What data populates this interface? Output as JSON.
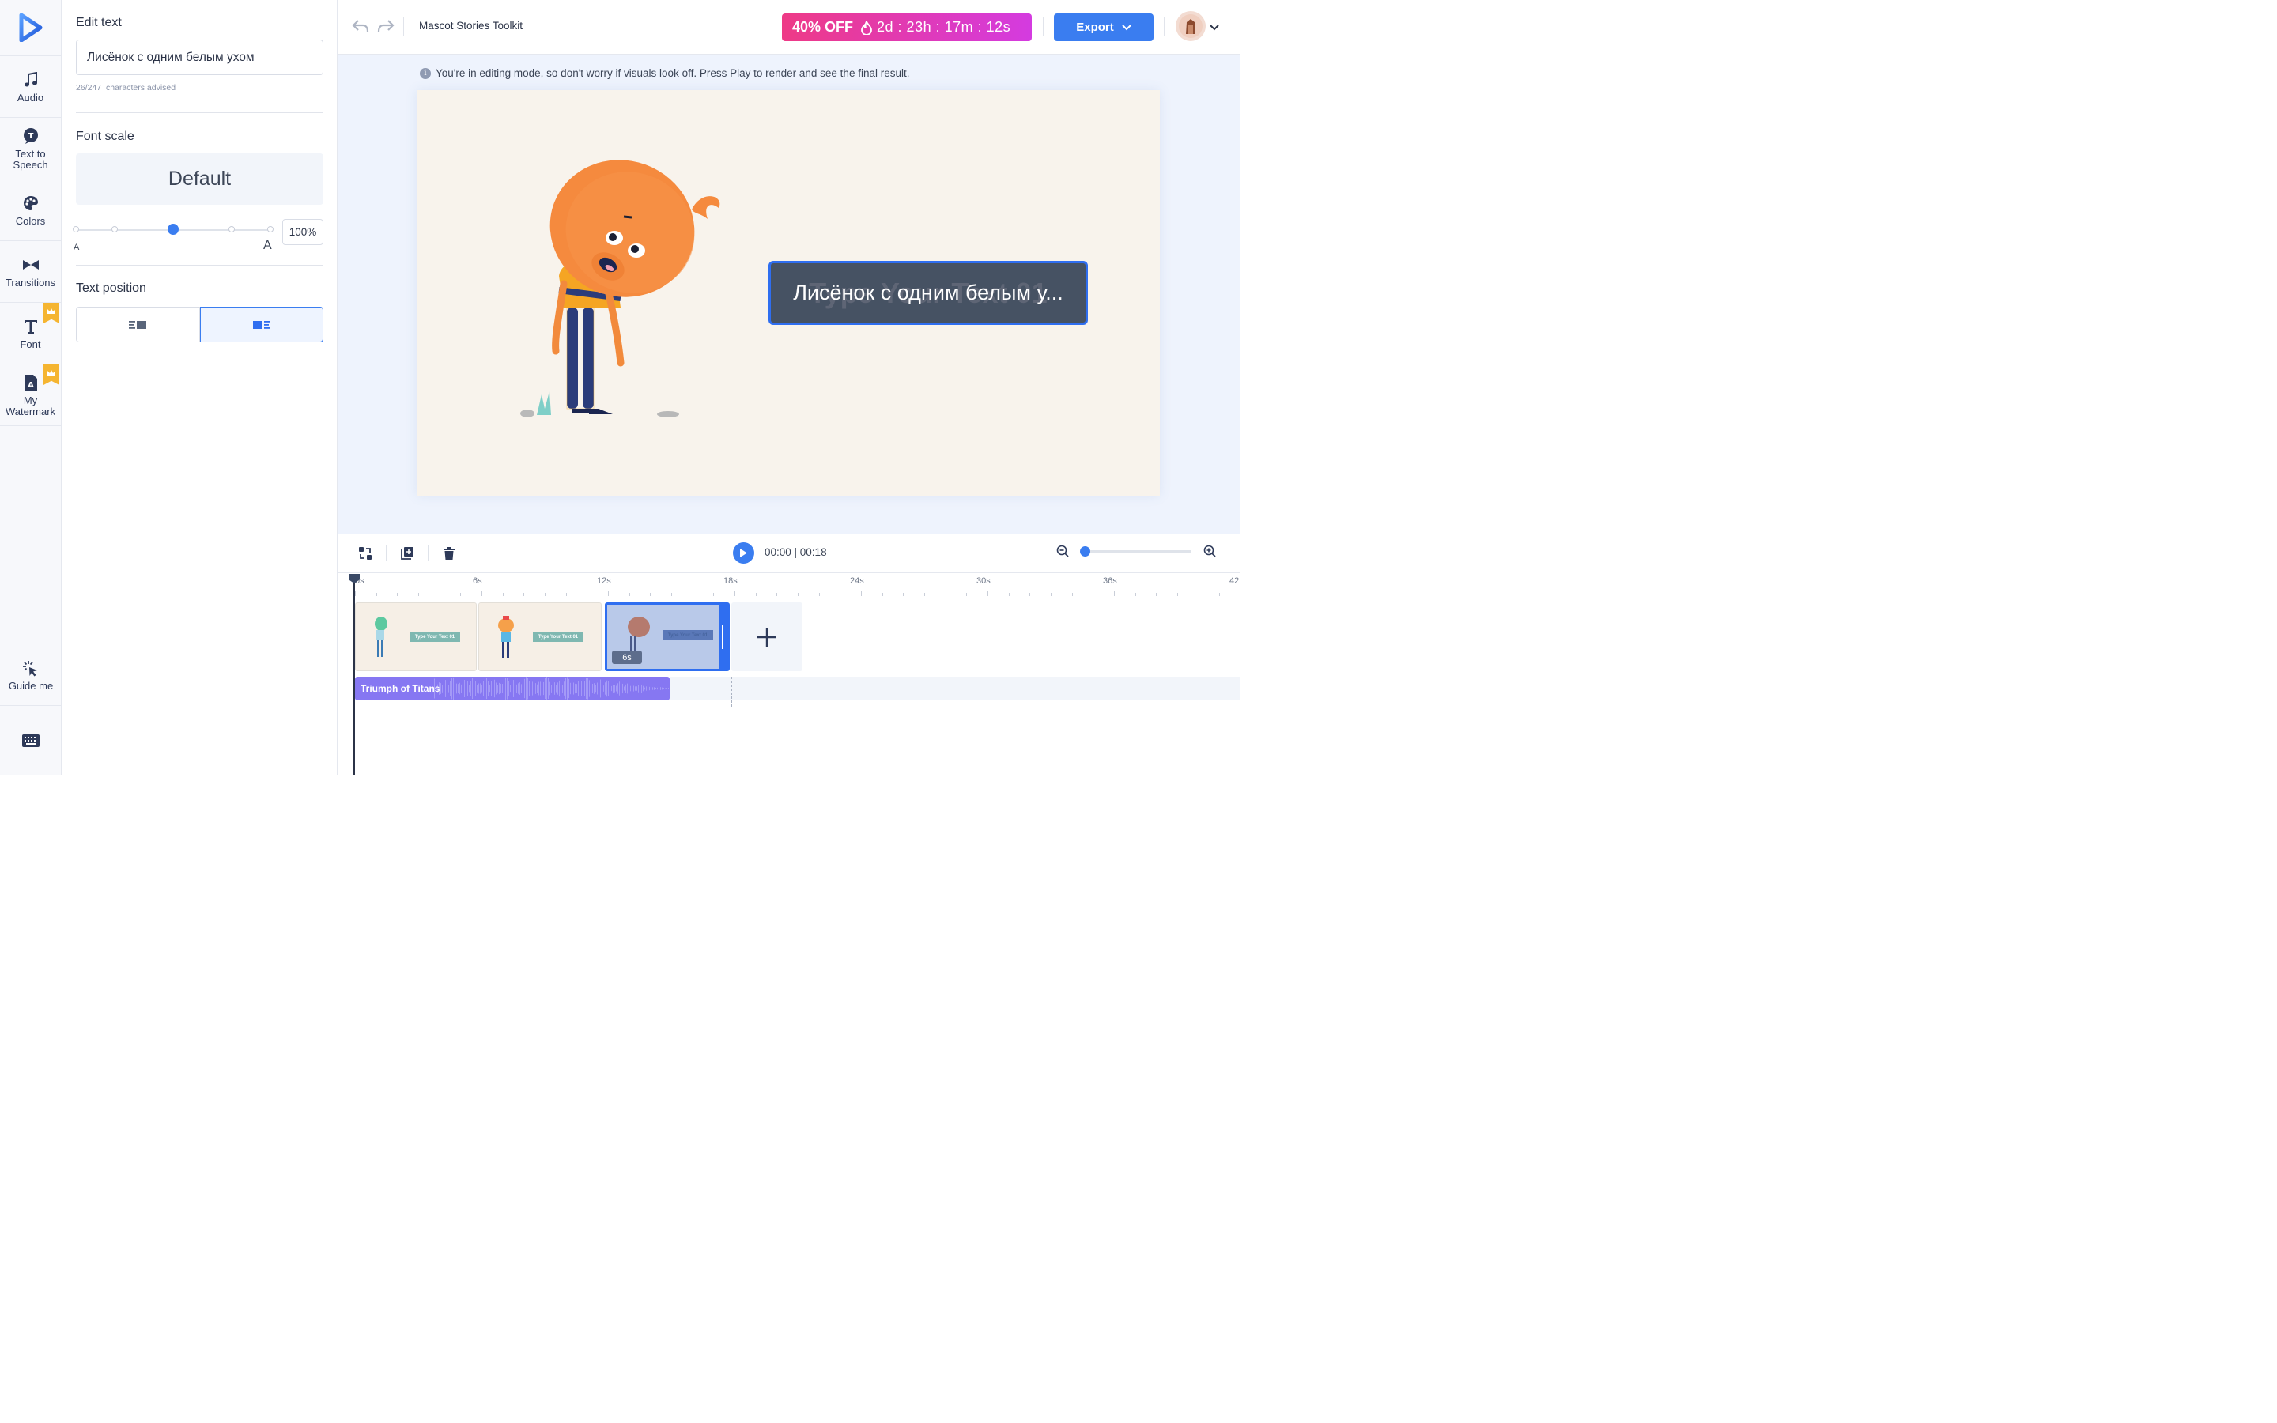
{
  "app": {
    "project_title": "Mascot Stories Toolkit"
  },
  "rail": {
    "items": [
      {
        "label": "Audio",
        "icon": "music-note-icon"
      },
      {
        "label": "Text to Speech",
        "icon": "text-to-speech-icon"
      },
      {
        "label": "Colors",
        "icon": "palette-icon"
      },
      {
        "label": "Transitions",
        "icon": "bowtie-transition-icon"
      },
      {
        "label": "Font",
        "icon": "font-t-icon",
        "premium": true
      },
      {
        "label": "My Watermark",
        "icon": "watermark-icon",
        "premium": true
      }
    ],
    "guide_label": "Guide me"
  },
  "panel": {
    "edit_text_title": "Edit text",
    "text_value": "Лисёнок с одним белым ухом",
    "char_count": "26/247",
    "char_hint": "characters advised",
    "font_scale_title": "Font scale",
    "font_scale_value": "Default",
    "scale_small_label": "A",
    "scale_big_label": "A",
    "scale_percent": "100%",
    "scale_level": 0.5,
    "text_position_title": "Text position",
    "text_position_selected": "right"
  },
  "topbar": {
    "promo_discount": "40% OFF",
    "promo_countdown": "2d : 23h : 17m : 12s",
    "export_label": "Export"
  },
  "stage": {
    "notice": "You're in editing mode, so don't worry if visuals look off. Press Play to render and see the final result.",
    "caption_text": "Лисёнок с одним белым у...",
    "caption_ghost": "Type Your Text 01"
  },
  "timeline": {
    "time_display": "00:00 | 00:18",
    "ruler_labels": [
      "0s",
      "6s",
      "12s",
      "18s",
      "24s",
      "30s",
      "36s",
      "42"
    ],
    "clips": [
      {
        "label": "Type Your Text 01"
      },
      {
        "label": "Type Your Text 01"
      },
      {
        "label": "Type Your Text 01",
        "duration": "6s",
        "selected": true
      }
    ],
    "audio_track": "Triumph of Titans",
    "zoom_level": 0
  },
  "colors": {
    "accent": "#3a7df0",
    "promo_start": "#ee3a86",
    "promo_end": "#d43be0",
    "audio": "#8677f2",
    "premium": "#f5b531"
  }
}
